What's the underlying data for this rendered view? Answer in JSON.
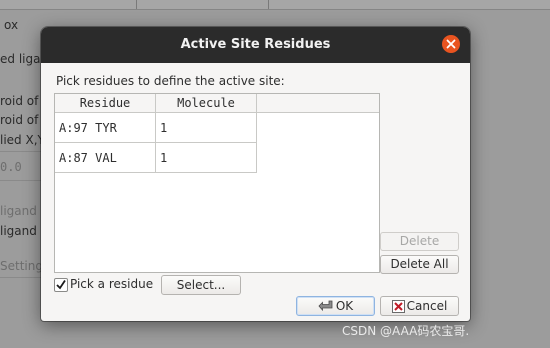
{
  "background": {
    "fragments": [
      "ox",
      "ed ligan",
      "roid of",
      "roid of",
      "lied X,Y",
      "0.0",
      "ligand",
      "ligand",
      "Settings"
    ]
  },
  "dialog": {
    "title": "Active Site Residues",
    "prompt": "Pick residues to define the active site:",
    "columns": [
      "Residue",
      "Molecule"
    ],
    "rows": [
      {
        "residue": "A:97 TYR",
        "molecule": "1"
      },
      {
        "residue": "A:87 VAL",
        "molecule": "1"
      }
    ],
    "buttons": {
      "delete": "Delete",
      "delete_all": "Delete All",
      "select": "Select...",
      "ok": "OK",
      "cancel": "Cancel"
    },
    "pick_residue": {
      "label": "Pick a residue",
      "checked": true
    }
  },
  "icons": {
    "close": "close-icon",
    "ok": "ok-icon",
    "cancel": "cancel-icon",
    "checkmark": "checkmark-icon"
  },
  "colors": {
    "titlebar": "#2b2b2b",
    "close_button": "#e95420",
    "dialog_bg": "#f6f5f4"
  },
  "watermark": "CSDN @AAA码农宝哥."
}
